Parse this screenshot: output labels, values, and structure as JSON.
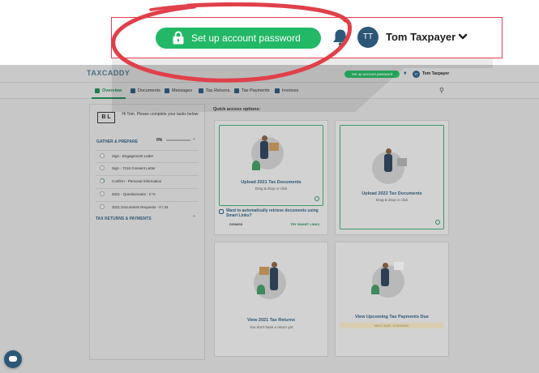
{
  "app": {
    "logo_text": "TAXCADDY",
    "mini_setup_label": "Set up account password",
    "mini_user_name": "Tom Taxpayer",
    "mini_avatar_initials": "TT"
  },
  "nav": {
    "items": [
      {
        "label": "Overview"
      },
      {
        "label": "Documents"
      },
      {
        "label": "Messages"
      },
      {
        "label": "Tax Returns"
      },
      {
        "label": "Tax Payments"
      },
      {
        "label": "Invoices"
      }
    ],
    "active_index": 0
  },
  "sidebar": {
    "badge": "B L",
    "greeting": "Hi Tom. Please complete your tasks below:",
    "gather_title": "GATHER & PREPARE",
    "gather_progress": "0%",
    "gather_progress_value": 0,
    "tasks": [
      {
        "label": "Sign - Engagement Letter",
        "state": "todo"
      },
      {
        "label": "Sign - 7216 Consent Letter",
        "state": "todo"
      },
      {
        "label": "Confirm - Personal Information",
        "state": "partial"
      },
      {
        "label": "2021 - Questionnaire - 0 %",
        "state": "todo"
      },
      {
        "label": "2021 Documents Requests - 0 / 34",
        "state": "todo"
      }
    ],
    "returns_title": "TAX RETURNS & PAYMENTS"
  },
  "quick_access": {
    "heading": "Quick access options:",
    "cards": [
      {
        "title": "Upload 2021 Tax Documents",
        "subtitle": "Drag & drop or click"
      },
      {
        "title": "Upload 2022 Tax Documents",
        "subtitle": "Drag & drop or click"
      },
      {
        "title": "View 2021 Tax Returns",
        "subtitle": "You don't have a return yet"
      },
      {
        "title": "View Upcoming Tax Payments Due",
        "subtitle": "NEXT DUE: 12/31/2022"
      }
    ],
    "smart_links_text": "Want to automatically retrieve documents using Smart Links?",
    "dismiss_label": "DISMISS",
    "try_label": "TRY SMART LINKS"
  },
  "callout": {
    "setup_label": "Set up account password",
    "avatar_initials": "TT",
    "user_name": "Tom Taxpayer"
  },
  "colors": {
    "accent_green": "#22b866",
    "brand_navy": "#2c5777",
    "highlight_red": "#e0404a"
  },
  "icons": {
    "lock": "lock-icon",
    "bell": "bell-icon",
    "chevron": "chevron-down-icon",
    "search": "search-icon",
    "chat": "chat-icon"
  }
}
